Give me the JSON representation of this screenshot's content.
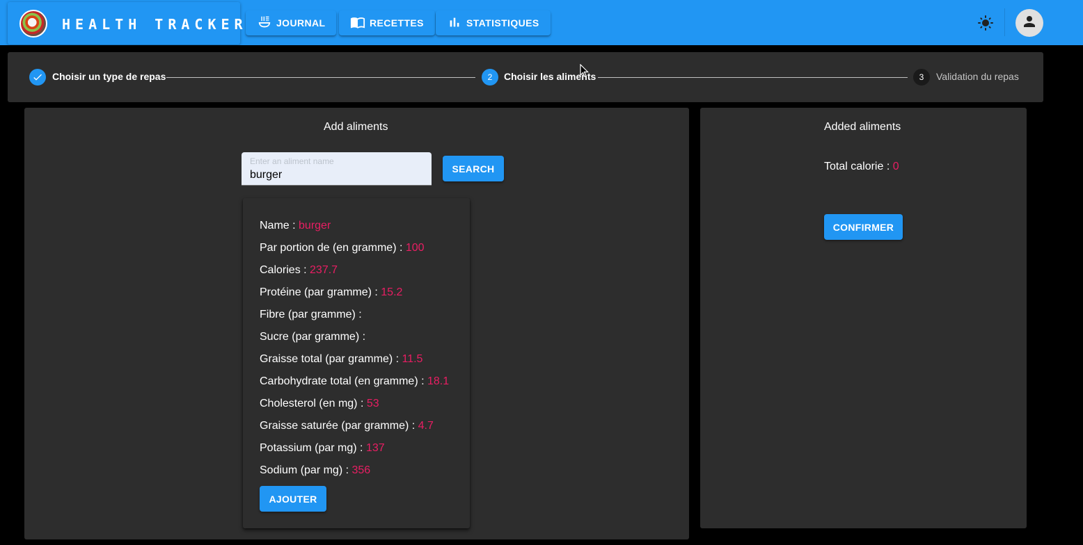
{
  "header": {
    "brand": "HEALTH TRACKER",
    "nav": [
      {
        "label": "JOURNAL",
        "icon": "bowl-icon"
      },
      {
        "label": "RECETTES",
        "icon": "book-icon"
      },
      {
        "label": "STATISTIQUES",
        "icon": "bar-chart-icon"
      }
    ],
    "theme_icon": "sun-icon",
    "avatar_icon": "person-icon"
  },
  "stepper": {
    "steps": [
      {
        "number": "1",
        "label": "Choisir un type de repas",
        "state": "completed"
      },
      {
        "number": "2",
        "label": "Choisir les aliments",
        "state": "active"
      },
      {
        "number": "3",
        "label": "Validation du repas",
        "state": "pending"
      }
    ]
  },
  "add_panel": {
    "title": "Add aliments",
    "search": {
      "placeholder": "Enter an aliment name",
      "value": "burger",
      "button": "SEARCH"
    },
    "result": {
      "rows": [
        {
          "label": "Name : ",
          "value": "burger"
        },
        {
          "label": "Par portion de (en gramme) : ",
          "value": "100"
        },
        {
          "label": "Calories : ",
          "value": "237.7"
        },
        {
          "label": "Protéine (par gramme) : ",
          "value": "15.2"
        },
        {
          "label": "Fibre (par gramme) : ",
          "value": ""
        },
        {
          "label": "Sucre (par gramme) : ",
          "value": ""
        },
        {
          "label": "Graisse total (par gramme) : ",
          "value": "11.5"
        },
        {
          "label": "Carbohydrate total (en gramme) : ",
          "value": "18.1"
        },
        {
          "label": "Cholesterol (en mg) : ",
          "value": "53"
        },
        {
          "label": "Graisse saturée (par gramme) : ",
          "value": "4.7"
        },
        {
          "label": "Potassium (par mg) : ",
          "value": "137"
        },
        {
          "label": "Sodium (par mg) : ",
          "value": "356"
        }
      ],
      "add_button": "AJOUTER"
    }
  },
  "added_panel": {
    "title": "Added aliments",
    "total_label": "Total calorie : ",
    "total_value": "0",
    "confirm_button": "CONFIRMER"
  },
  "colors": {
    "primary": "#2196f3",
    "accent_value": "#e91e63",
    "panel": "#2d2d2d",
    "background": "#000000"
  }
}
